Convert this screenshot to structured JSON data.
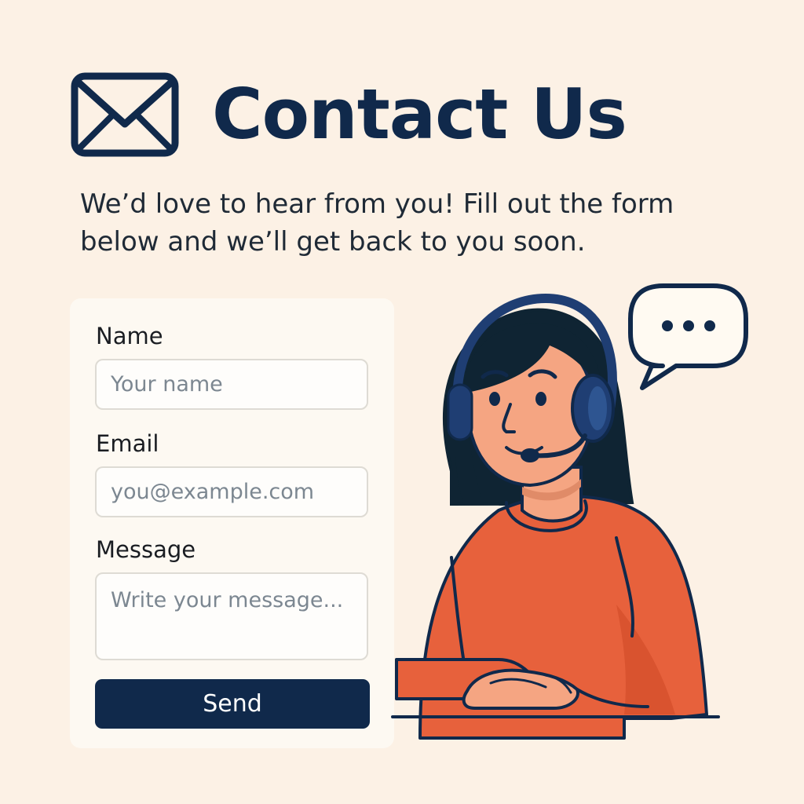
{
  "header": {
    "title": "Contact Us",
    "icon": "envelope-icon"
  },
  "intro": {
    "line1": "We’d love to hear from you! Fill out the form",
    "line2": "below and we’ll get back to you soon."
  },
  "form": {
    "name_label": "Name",
    "name_placeholder": "Your name",
    "name_value": "",
    "email_label": "Email",
    "email_placeholder": "you@example.com",
    "email_value": "",
    "message_label": "Message",
    "message_placeholder": "Write your message...",
    "message_value": "",
    "send_label": "Send"
  },
  "illustration": {
    "speech_bubble_icon": "speech-bubble-ellipsis-icon",
    "agent": "support-agent-with-headset"
  },
  "colors": {
    "background": "#fcf1e5",
    "navy": "#10294b",
    "sweater": "#e7613c",
    "skin": "#f5a582",
    "hair": "#0f2433"
  }
}
